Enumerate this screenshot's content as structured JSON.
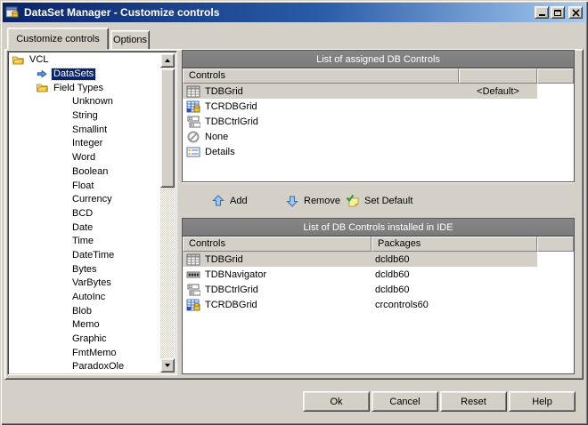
{
  "window": {
    "title": "DataSet Manager - Customize controls"
  },
  "tabs": [
    {
      "label": "Customize controls",
      "active": true
    },
    {
      "label": "Options",
      "active": false
    }
  ],
  "tree": {
    "items": [
      {
        "label": "VCL",
        "level": 0,
        "icon": "folder-open-icon"
      },
      {
        "label": "DataSets",
        "level": 1,
        "icon": "dataset-arrow-icon",
        "selected": true
      },
      {
        "label": "Field Types",
        "level": 1,
        "icon": "folder-open-icon"
      },
      {
        "label": "Unknown",
        "level": 2
      },
      {
        "label": "String",
        "level": 2
      },
      {
        "label": "Smallint",
        "level": 2
      },
      {
        "label": "Integer",
        "level": 2
      },
      {
        "label": "Word",
        "level": 2
      },
      {
        "label": "Boolean",
        "level": 2
      },
      {
        "label": "Float",
        "level": 2
      },
      {
        "label": "Currency",
        "level": 2
      },
      {
        "label": "BCD",
        "level": 2
      },
      {
        "label": "Date",
        "level": 2
      },
      {
        "label": "Time",
        "level": 2
      },
      {
        "label": "DateTime",
        "level": 2
      },
      {
        "label": "Bytes",
        "level": 2
      },
      {
        "label": "VarBytes",
        "level": 2
      },
      {
        "label": "AutoInc",
        "level": 2
      },
      {
        "label": "Blob",
        "level": 2
      },
      {
        "label": "Memo",
        "level": 2
      },
      {
        "label": "Graphic",
        "level": 2
      },
      {
        "label": "FmtMemo",
        "level": 2
      },
      {
        "label": "ParadoxOle",
        "level": 2
      }
    ]
  },
  "assigned_panel": {
    "title": "List of assigned DB Controls",
    "columns": [
      "Controls",
      "",
      ""
    ],
    "rows": [
      {
        "control": "TDBGrid",
        "value": "<Default>",
        "icon": "dbgrid-icon",
        "selected": true
      },
      {
        "control": "TCRDBGrid",
        "value": "",
        "icon": "crdbgrid-icon"
      },
      {
        "control": "TDBCtrlGrid",
        "value": "",
        "icon": "dbctrlgrid-icon"
      },
      {
        "control": "None",
        "value": "",
        "icon": "none-icon"
      },
      {
        "control": "Details",
        "value": "",
        "icon": "details-icon"
      }
    ]
  },
  "toolbar": {
    "add_label": "Add",
    "remove_label": "Remove",
    "set_default_label": "Set Default"
  },
  "installed_panel": {
    "title": "List of DB Controls installed in IDE",
    "columns": [
      "Controls",
      "Packages",
      ""
    ],
    "rows": [
      {
        "control": "TDBGrid",
        "package": "dcldb60",
        "icon": "dbgrid-icon",
        "selected": true
      },
      {
        "control": "TDBNavigator",
        "package": "dcldb60",
        "icon": "dbnavigator-icon"
      },
      {
        "control": "TDBCtrlGrid",
        "package": "dcldb60",
        "icon": "dbctrlgrid-icon"
      },
      {
        "control": "TCRDBGrid",
        "package": "crcontrols60",
        "icon": "crdbgrid-icon"
      }
    ]
  },
  "footer": {
    "ok_label": "Ok",
    "cancel_label": "Cancel",
    "reset_label": "Reset",
    "help_label": "Help"
  },
  "colors": {
    "dialog_bg": "#d4d0c8",
    "titlebar_start": "#0a246a",
    "titlebar_end": "#a6caf0",
    "panel_header_bg": "#808080",
    "panel_header_text": "#ffffff",
    "selection_bg": "#0a246a",
    "inactive_selection_bg": "#d4d0c8"
  }
}
